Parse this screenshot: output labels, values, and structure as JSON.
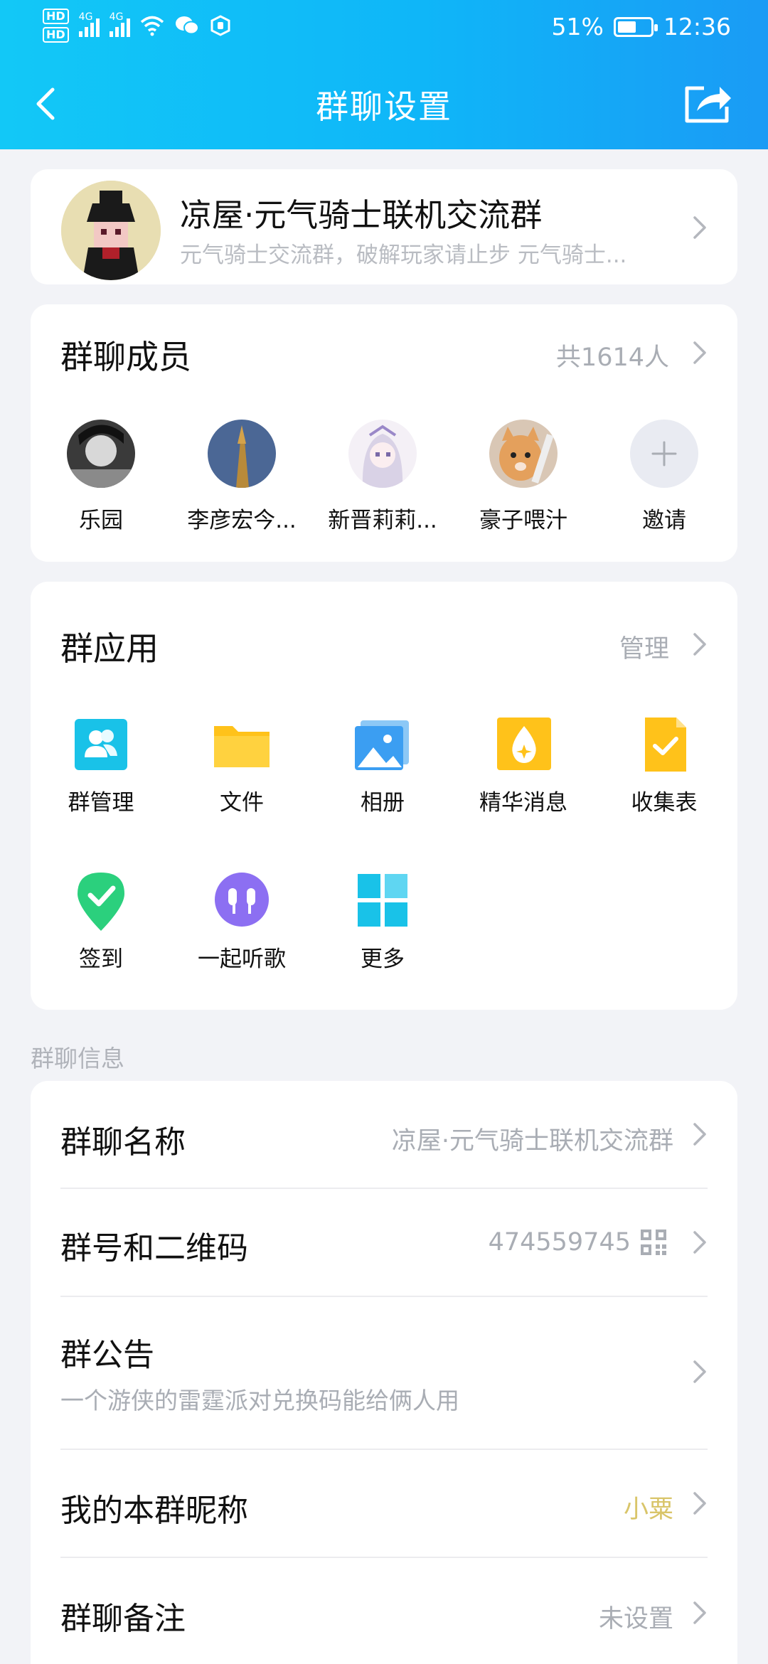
{
  "status_bar": {
    "hd1": "HD",
    "hd2": "HD",
    "net1": "4G",
    "net2": "4G",
    "battery": "51%",
    "time": "12:36"
  },
  "nav": {
    "title": "群聊设置"
  },
  "group": {
    "name": "凉屋·元气骑士联机交流群",
    "description": "元气骑士交流群，破解玩家请止步  元气骑士..."
  },
  "members": {
    "title": "群聊成员",
    "count": "共1614人",
    "list": [
      {
        "name": "乐园"
      },
      {
        "name": "李彦宏今..."
      },
      {
        "name": "新晋莉莉..."
      },
      {
        "name": "豪子喂汁"
      }
    ],
    "invite_label": "邀请"
  },
  "apps": {
    "title": "群应用",
    "manage": "管理",
    "items": [
      {
        "label": "群管理",
        "icon": "group-manage-icon"
      },
      {
        "label": "文件",
        "icon": "folder-icon"
      },
      {
        "label": "相册",
        "icon": "album-icon"
      },
      {
        "label": "精华消息",
        "icon": "essence-icon"
      },
      {
        "label": "收集表",
        "icon": "form-icon"
      },
      {
        "label": "签到",
        "icon": "checkin-icon"
      },
      {
        "label": "一起听歌",
        "icon": "headphones-icon"
      },
      {
        "label": "更多",
        "icon": "more-grid-icon"
      }
    ]
  },
  "info": {
    "section_label": "群聊信息",
    "group_name_label": "群聊名称",
    "group_name_value": "凉屋·元气骑士联机交流群",
    "group_id_label": "群号和二维码",
    "group_id_value": "474559745",
    "announcement_label": "群公告",
    "announcement_value": "一个游侠的雷霆派对兑换码能给俩人用",
    "nickname_label": "我的本群昵称",
    "nickname_value": "小粟",
    "remark_label": "群聊备注",
    "remark_value": "未设置"
  },
  "colors": {
    "header_start": "#12c8f7",
    "header_end": "#1a9bf5",
    "nickname": "#d9c56a",
    "muted": "#a9adb4"
  }
}
